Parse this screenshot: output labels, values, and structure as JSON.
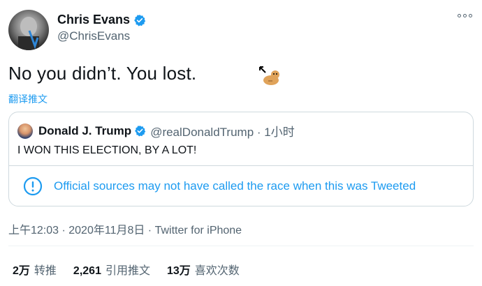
{
  "author": {
    "display_name": "Chris Evans",
    "handle": "@ChrisEvans"
  },
  "tweet": {
    "text": "No you didn’t. You lost.",
    "translate_label": "翻译推文"
  },
  "quoted": {
    "display_name": "Donald J. Trump",
    "handle_time": "@realDonaldTrump · 1小时",
    "text": "I WON THIS ELECTION, BY A LOT!",
    "notice": "Official sources may not have called the race when this was Tweeted"
  },
  "meta": {
    "timestamp": "上午12:03 · 2020年11月8日 · Twitter for iPhone"
  },
  "stats": [
    {
      "num": "2万",
      "label": "转推"
    },
    {
      "num": "2,261",
      "label": "引用推文"
    },
    {
      "num": "13万",
      "label": "喜欢次数"
    }
  ],
  "colors": {
    "link_blue": "#1d9bf0",
    "secondary_text": "#536471",
    "border": "#cfd9de"
  },
  "icons": {
    "verified": "verified-badge-icon",
    "more": "more-options-icon",
    "notice": "exclamation-circle-icon"
  }
}
